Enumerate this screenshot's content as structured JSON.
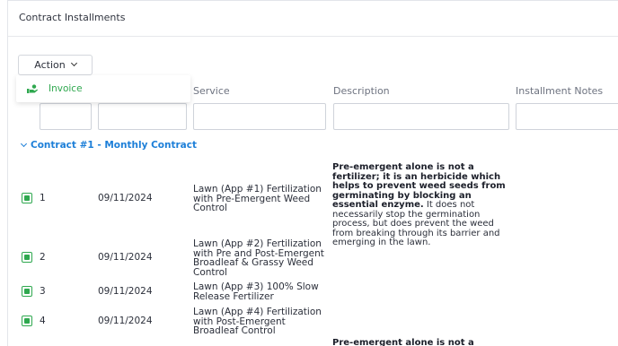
{
  "panel": {
    "title": "Contract Installments"
  },
  "toolbar": {
    "action_label": "Action"
  },
  "action_menu": {
    "items": [
      {
        "label": "Invoice",
        "icon": "hand-money-icon"
      }
    ]
  },
  "columns": {
    "service": "Service",
    "description": "Description",
    "installment_notes": "Installment Notes"
  },
  "group": {
    "label": "Contract #1 - Monthly Contract"
  },
  "rows": [
    {
      "checked": true,
      "number": "1",
      "date": "09/11/2024",
      "service": "Lawn (App #1) Fertilization with Pre-Emergent Weed Control",
      "description_bold": "Pre-emergent alone is not a fertilizer; it is an herbicide which helps to prevent weed seeds from germinating by blocking an essential enzyme.",
      "description_rest": " It does not necessarily stop the germination process, but does prevent the weed from breaking through its barrier and emerging in the lawn."
    },
    {
      "checked": true,
      "number": "2",
      "date": "09/11/2024",
      "service": "Lawn (App #2) Fertilization with Pre and Post-Emergent Broadleaf & Grassy Weed Control",
      "description_bold": "",
      "description_rest": ""
    },
    {
      "checked": true,
      "number": "3",
      "date": "09/11/2024",
      "service": "Lawn (App #3) 100% Slow Release Fertilizer",
      "description_bold": "",
      "description_rest": ""
    },
    {
      "checked": true,
      "number": "4",
      "date": "09/11/2024",
      "service": "Lawn (App #4) Fertilization with Post-Emergent Broadleaf Control",
      "description_bold": "",
      "description_rest": ""
    },
    {
      "checked": false,
      "number": "",
      "date": "",
      "service": "",
      "description_bold": "Pre-emergent alone is not a fertilizer;",
      "description_rest": ""
    }
  ],
  "colors": {
    "accent_green": "#2fa84f",
    "group_blue": "#1d7fd8",
    "border": "#cfd3da"
  }
}
